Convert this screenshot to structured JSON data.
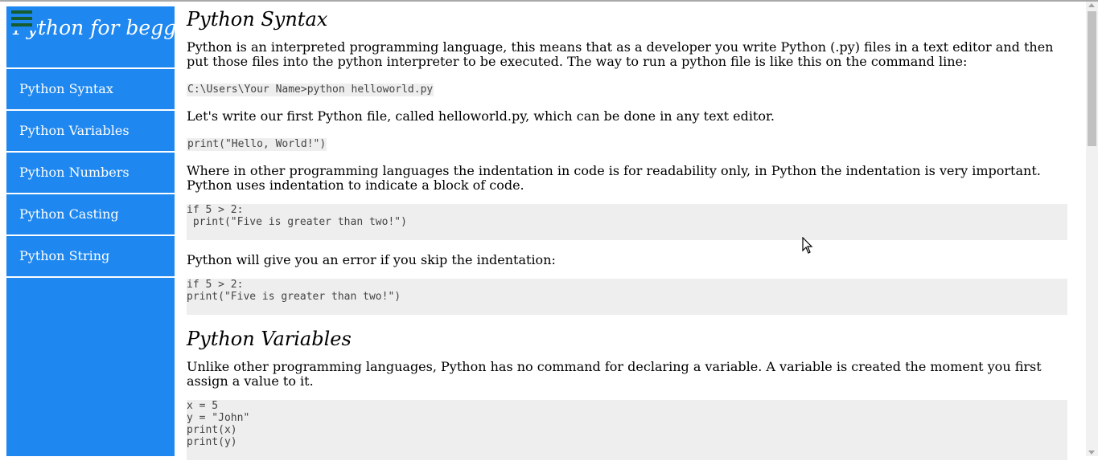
{
  "sidebar": {
    "brand": "Python for begginer",
    "items": [
      {
        "label": "Python Syntax"
      },
      {
        "label": "Python Variables"
      },
      {
        "label": "Python Numbers"
      },
      {
        "label": "Python Casting"
      },
      {
        "label": "Python String"
      }
    ]
  },
  "main": {
    "syntax": {
      "title": "Python Syntax",
      "p1": "Python is an interpreted programming language, this means that as a developer you write Python (.py) files in a text editor and then put those files into the python interpreter to be executed. The way to run a python file is like this on the command line:",
      "code1": "C:\\Users\\Your Name>python helloworld.py",
      "p2": "Let's write our first Python file, called helloworld.py, which can be done in any text editor.",
      "code2": "print(\"Hello, World!\")",
      "p3": "Where in other programming languages the indentation in code is for readability only, in Python the indentation is very important. Python uses indentation to indicate a block of code.",
      "code3": "if 5 > 2:\n print(\"Five is greater than two!\")",
      "p4": "Python will give you an error if you skip the indentation:",
      "code4": "if 5 > 2:\nprint(\"Five is greater than two!\")"
    },
    "variables": {
      "title": "Python Variables",
      "p1": "Unlike other programming languages, Python has no command for declaring a variable. A variable is created the moment you first assign a value to it.",
      "code1": "x = 5\ny = \"John\"\nprint(x)\nprint(y)"
    }
  },
  "icons": {
    "menu": "hamburger-menu-icon",
    "cursor": "mouse-pointer-icon"
  },
  "colors": {
    "sidebar": "#1e87f0",
    "menu_lines": "#155c2e",
    "code_bg": "#eeeeee"
  }
}
